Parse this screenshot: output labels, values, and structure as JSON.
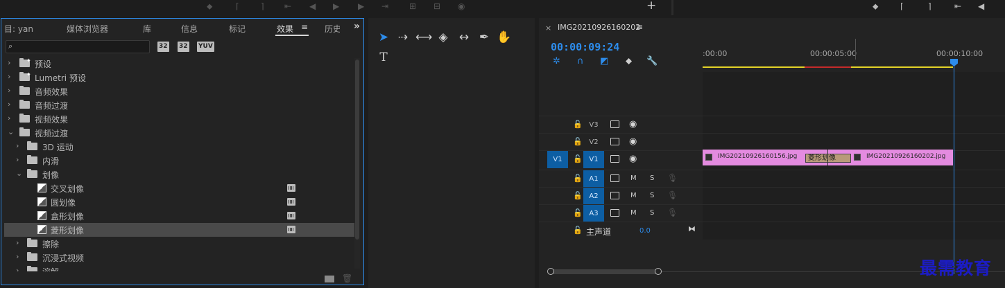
{
  "effects_panel": {
    "tabs": [
      {
        "label": "目: yan"
      },
      {
        "label": "媒体浏览器"
      },
      {
        "label": "库"
      },
      {
        "label": "信息"
      },
      {
        "label": "标记"
      },
      {
        "label": "效果",
        "active": true
      },
      {
        "label": "历史"
      }
    ],
    "search": {
      "value": "",
      "placeholder": ""
    },
    "filter_badges": [
      "32",
      "32",
      "YUV"
    ],
    "tree": [
      {
        "label": "预设",
        "type": "preset-folder",
        "indent": 0,
        "expanded": false
      },
      {
        "label": "Lumetri 预设",
        "type": "preset-folder",
        "indent": 0,
        "expanded": false
      },
      {
        "label": "音频效果",
        "type": "folder",
        "indent": 0,
        "expanded": false
      },
      {
        "label": "音频过渡",
        "type": "folder",
        "indent": 0,
        "expanded": false
      },
      {
        "label": "视频效果",
        "type": "folder",
        "indent": 0,
        "expanded": false
      },
      {
        "label": "视频过渡",
        "type": "folder",
        "indent": 0,
        "expanded": true
      },
      {
        "label": "3D 运动",
        "type": "folder",
        "indent": 1,
        "expanded": false
      },
      {
        "label": "内滑",
        "type": "folder",
        "indent": 1,
        "expanded": false
      },
      {
        "label": "划像",
        "type": "folder",
        "indent": 1,
        "expanded": true
      },
      {
        "label": "交叉划像",
        "type": "effect",
        "indent": 2,
        "gpu": true
      },
      {
        "label": "圆划像",
        "type": "effect",
        "indent": 2,
        "gpu": true
      },
      {
        "label": "盒形划像",
        "type": "effect",
        "indent": 2,
        "gpu": true
      },
      {
        "label": "菱形划像",
        "type": "effect",
        "indent": 2,
        "gpu": true,
        "selected": true
      },
      {
        "label": "擦除",
        "type": "folder",
        "indent": 1,
        "expanded": false
      },
      {
        "label": "沉浸式视频",
        "type": "folder",
        "indent": 1,
        "expanded": false
      },
      {
        "label": "溶解",
        "type": "folder",
        "indent": 1,
        "expanded": false
      }
    ]
  },
  "timeline": {
    "sequence_name": "IMG20210926160202",
    "timecode": "00:00:09:24",
    "ruler_labels": [
      ":00:00",
      "00:00:05:00",
      "00:00:10:00"
    ],
    "video_tracks": [
      {
        "name": "V3",
        "source": "",
        "active": false
      },
      {
        "name": "V2",
        "source": "",
        "active": false
      },
      {
        "name": "V1",
        "source": "V1",
        "active": true
      }
    ],
    "audio_tracks": [
      {
        "name": "A1",
        "m": "M",
        "s": "S"
      },
      {
        "name": "A2",
        "m": "M",
        "s": "S"
      },
      {
        "name": "A3",
        "m": "M",
        "s": "S"
      }
    ],
    "master": {
      "label": "主声道",
      "value": "0.0"
    },
    "clips": [
      {
        "name": "IMG20210926160156.jpg"
      },
      {
        "name": "IMG20210926160202.jpg"
      }
    ],
    "transition": {
      "name": "菱形划像"
    }
  },
  "colors": {
    "accent": "#2d8ceb",
    "clip": "#e48be0",
    "transition": "#b89a79",
    "work_area": "#e5d428",
    "render_red": "#c62a2a"
  },
  "watermark": "最需教育"
}
